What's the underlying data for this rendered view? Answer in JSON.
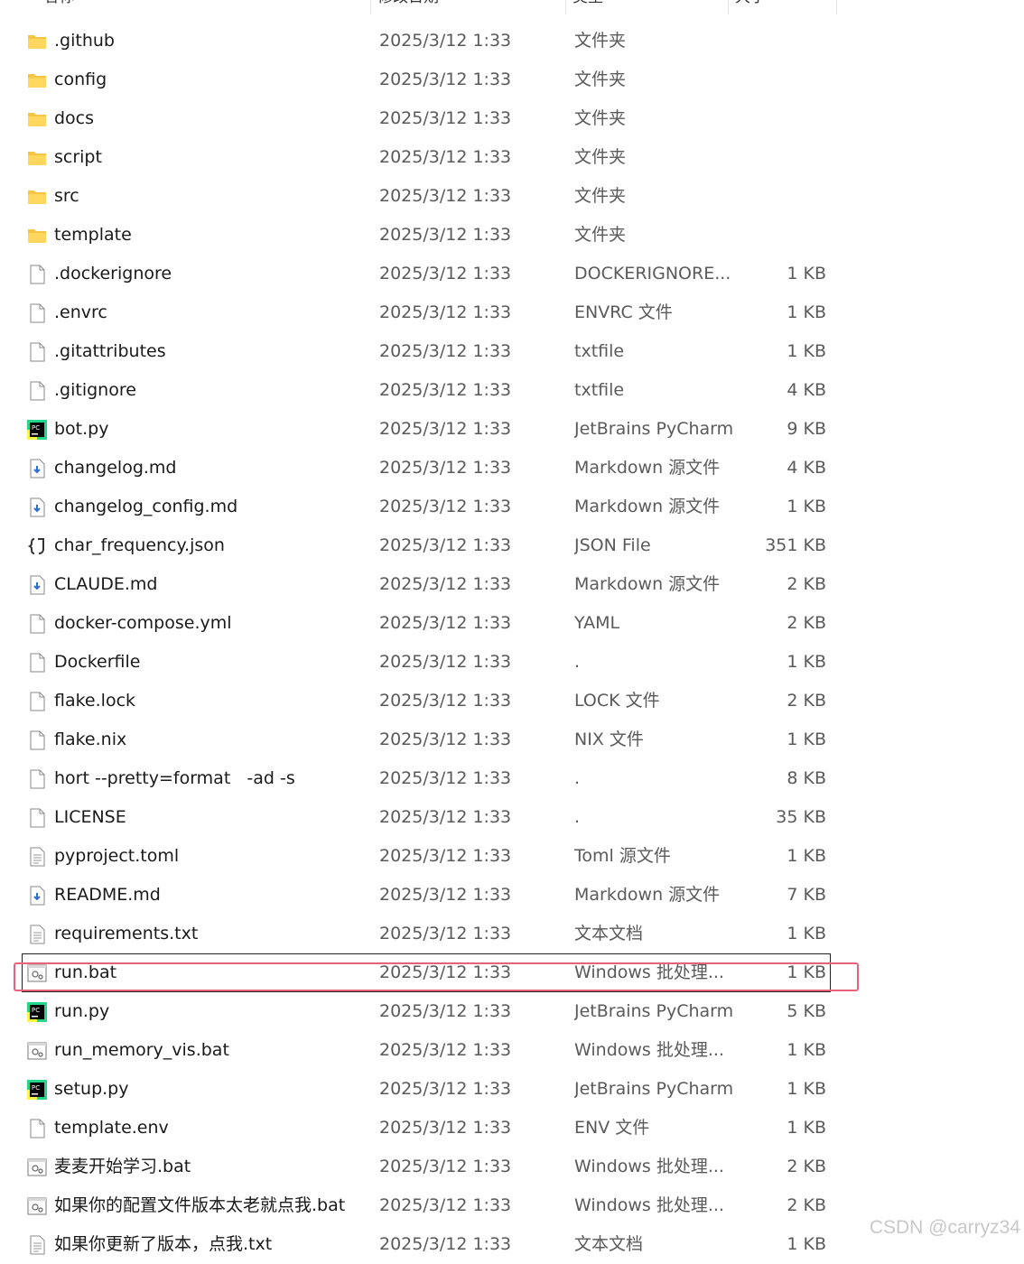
{
  "header": {
    "name": "名称",
    "date": "修改日期",
    "type": "类型",
    "size": "大小"
  },
  "files": [
    {
      "icon": "folder-icon",
      "name": ".github",
      "date": "2025/3/12 1:33",
      "type": "文件夹",
      "size": ""
    },
    {
      "icon": "folder-icon",
      "name": "config",
      "date": "2025/3/12 1:33",
      "type": "文件夹",
      "size": ""
    },
    {
      "icon": "folder-icon",
      "name": "docs",
      "date": "2025/3/12 1:33",
      "type": "文件夹",
      "size": ""
    },
    {
      "icon": "folder-icon",
      "name": "script",
      "date": "2025/3/12 1:33",
      "type": "文件夹",
      "size": ""
    },
    {
      "icon": "folder-icon",
      "name": "src",
      "date": "2025/3/12 1:33",
      "type": "文件夹",
      "size": ""
    },
    {
      "icon": "folder-icon",
      "name": "template",
      "date": "2025/3/12 1:33",
      "type": "文件夹",
      "size": ""
    },
    {
      "icon": "file-icon",
      "name": ".dockerignore",
      "date": "2025/3/12 1:33",
      "type": "DOCKERIGNORE...",
      "size": "1 KB"
    },
    {
      "icon": "file-icon",
      "name": ".envrc",
      "date": "2025/3/12 1:33",
      "type": "ENVRC 文件",
      "size": "1 KB"
    },
    {
      "icon": "file-icon",
      "name": ".gitattributes",
      "date": "2025/3/12 1:33",
      "type": "txtfile",
      "size": "1 KB"
    },
    {
      "icon": "file-icon",
      "name": ".gitignore",
      "date": "2025/3/12 1:33",
      "type": "txtfile",
      "size": "4 KB"
    },
    {
      "icon": "pycharm-icon",
      "name": "bot.py",
      "date": "2025/3/12 1:33",
      "type": "JetBrains PyCharm",
      "size": "9 KB"
    },
    {
      "icon": "markdown-icon",
      "name": "changelog.md",
      "date": "2025/3/12 1:33",
      "type": "Markdown 源文件",
      "size": "4 KB"
    },
    {
      "icon": "markdown-icon",
      "name": "changelog_config.md",
      "date": "2025/3/12 1:33",
      "type": "Markdown 源文件",
      "size": "1 KB"
    },
    {
      "icon": "json-icon",
      "name": "char_frequency.json",
      "date": "2025/3/12 1:33",
      "type": "JSON File",
      "size": "351 KB"
    },
    {
      "icon": "markdown-icon",
      "name": "CLAUDE.md",
      "date": "2025/3/12 1:33",
      "type": "Markdown 源文件",
      "size": "2 KB"
    },
    {
      "icon": "file-icon",
      "name": "docker-compose.yml",
      "date": "2025/3/12 1:33",
      "type": "YAML",
      "size": "2 KB"
    },
    {
      "icon": "file-icon",
      "name": "Dockerfile",
      "date": "2025/3/12 1:33",
      "type": ".",
      "size": "1 KB"
    },
    {
      "icon": "file-icon",
      "name": "flake.lock",
      "date": "2025/3/12 1:33",
      "type": "LOCK 文件",
      "size": "2 KB"
    },
    {
      "icon": "file-icon",
      "name": "flake.nix",
      "date": "2025/3/12 1:33",
      "type": "NIX 文件",
      "size": "1 KB"
    },
    {
      "icon": "file-icon",
      "name": "hort --pretty=format   -ad -s",
      "date": "2025/3/12 1:33",
      "type": ".",
      "size": "8 KB"
    },
    {
      "icon": "file-icon",
      "name": "LICENSE",
      "date": "2025/3/12 1:33",
      "type": ".",
      "size": "35 KB"
    },
    {
      "icon": "text-file-icon",
      "name": "pyproject.toml",
      "date": "2025/3/12 1:33",
      "type": "Toml 源文件",
      "size": "1 KB"
    },
    {
      "icon": "markdown-icon",
      "name": "README.md",
      "date": "2025/3/12 1:33",
      "type": "Markdown 源文件",
      "size": "7 KB"
    },
    {
      "icon": "text-file-icon",
      "name": "requirements.txt",
      "date": "2025/3/12 1:33",
      "type": "文本文档",
      "size": "1 KB"
    },
    {
      "icon": "batch-file-icon",
      "name": "run.bat",
      "date": "2025/3/12 1:33",
      "type": "Windows 批处理...",
      "size": "1 KB",
      "selected": true
    },
    {
      "icon": "pycharm-icon",
      "name": "run.py",
      "date": "2025/3/12 1:33",
      "type": "JetBrains PyCharm",
      "size": "5 KB"
    },
    {
      "icon": "batch-file-icon",
      "name": "run_memory_vis.bat",
      "date": "2025/3/12 1:33",
      "type": "Windows 批处理...",
      "size": "1 KB"
    },
    {
      "icon": "pycharm-icon",
      "name": "setup.py",
      "date": "2025/3/12 1:33",
      "type": "JetBrains PyCharm",
      "size": "1 KB"
    },
    {
      "icon": "file-icon",
      "name": "template.env",
      "date": "2025/3/12 1:33",
      "type": "ENV 文件",
      "size": "1 KB"
    },
    {
      "icon": "batch-file-icon",
      "name": "麦麦开始学习.bat",
      "date": "2025/3/12 1:33",
      "type": "Windows 批处理...",
      "size": "2 KB"
    },
    {
      "icon": "batch-file-icon",
      "name": "如果你的配置文件版本太老就点我.bat",
      "date": "2025/3/12 1:33",
      "type": "Windows 批处理...",
      "size": "2 KB"
    },
    {
      "icon": "text-file-icon",
      "name": "如果你更新了版本，点我.txt",
      "date": "2025/3/12 1:33",
      "type": "文本文档",
      "size": "1 KB"
    }
  ],
  "watermark": "CSDN @carryz34",
  "colors": {
    "highlight": "#e8607a",
    "folder": "#f4c542",
    "pycharm_green": "#21d789"
  }
}
